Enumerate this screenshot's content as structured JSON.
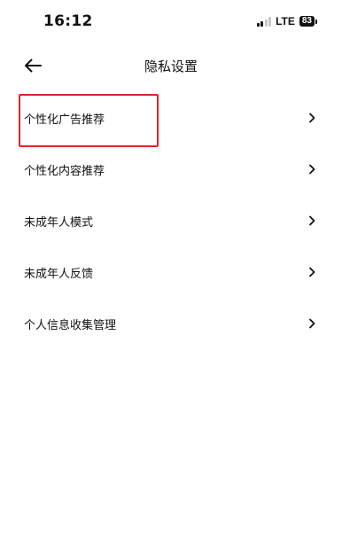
{
  "status_bar": {
    "time": "16:12",
    "network": "LTE",
    "battery": "83",
    "signal_icon": "signal-strength-icon"
  },
  "header": {
    "title": "隐私设置",
    "back_icon": "arrow-left-icon"
  },
  "menu": {
    "items": [
      {
        "label": "个性化广告推荐",
        "icon": "chevron-right-icon",
        "highlighted": true
      },
      {
        "label": "个性化内容推荐",
        "icon": "chevron-right-icon"
      },
      {
        "label": "未成年人模式",
        "icon": "chevron-right-icon"
      },
      {
        "label": "未成年人反馈",
        "icon": "chevron-right-icon"
      },
      {
        "label": "个人信息收集管理",
        "icon": "chevron-right-icon"
      }
    ]
  },
  "colors": {
    "highlight": "#e02424",
    "text": "#111111",
    "background": "#ffffff"
  }
}
